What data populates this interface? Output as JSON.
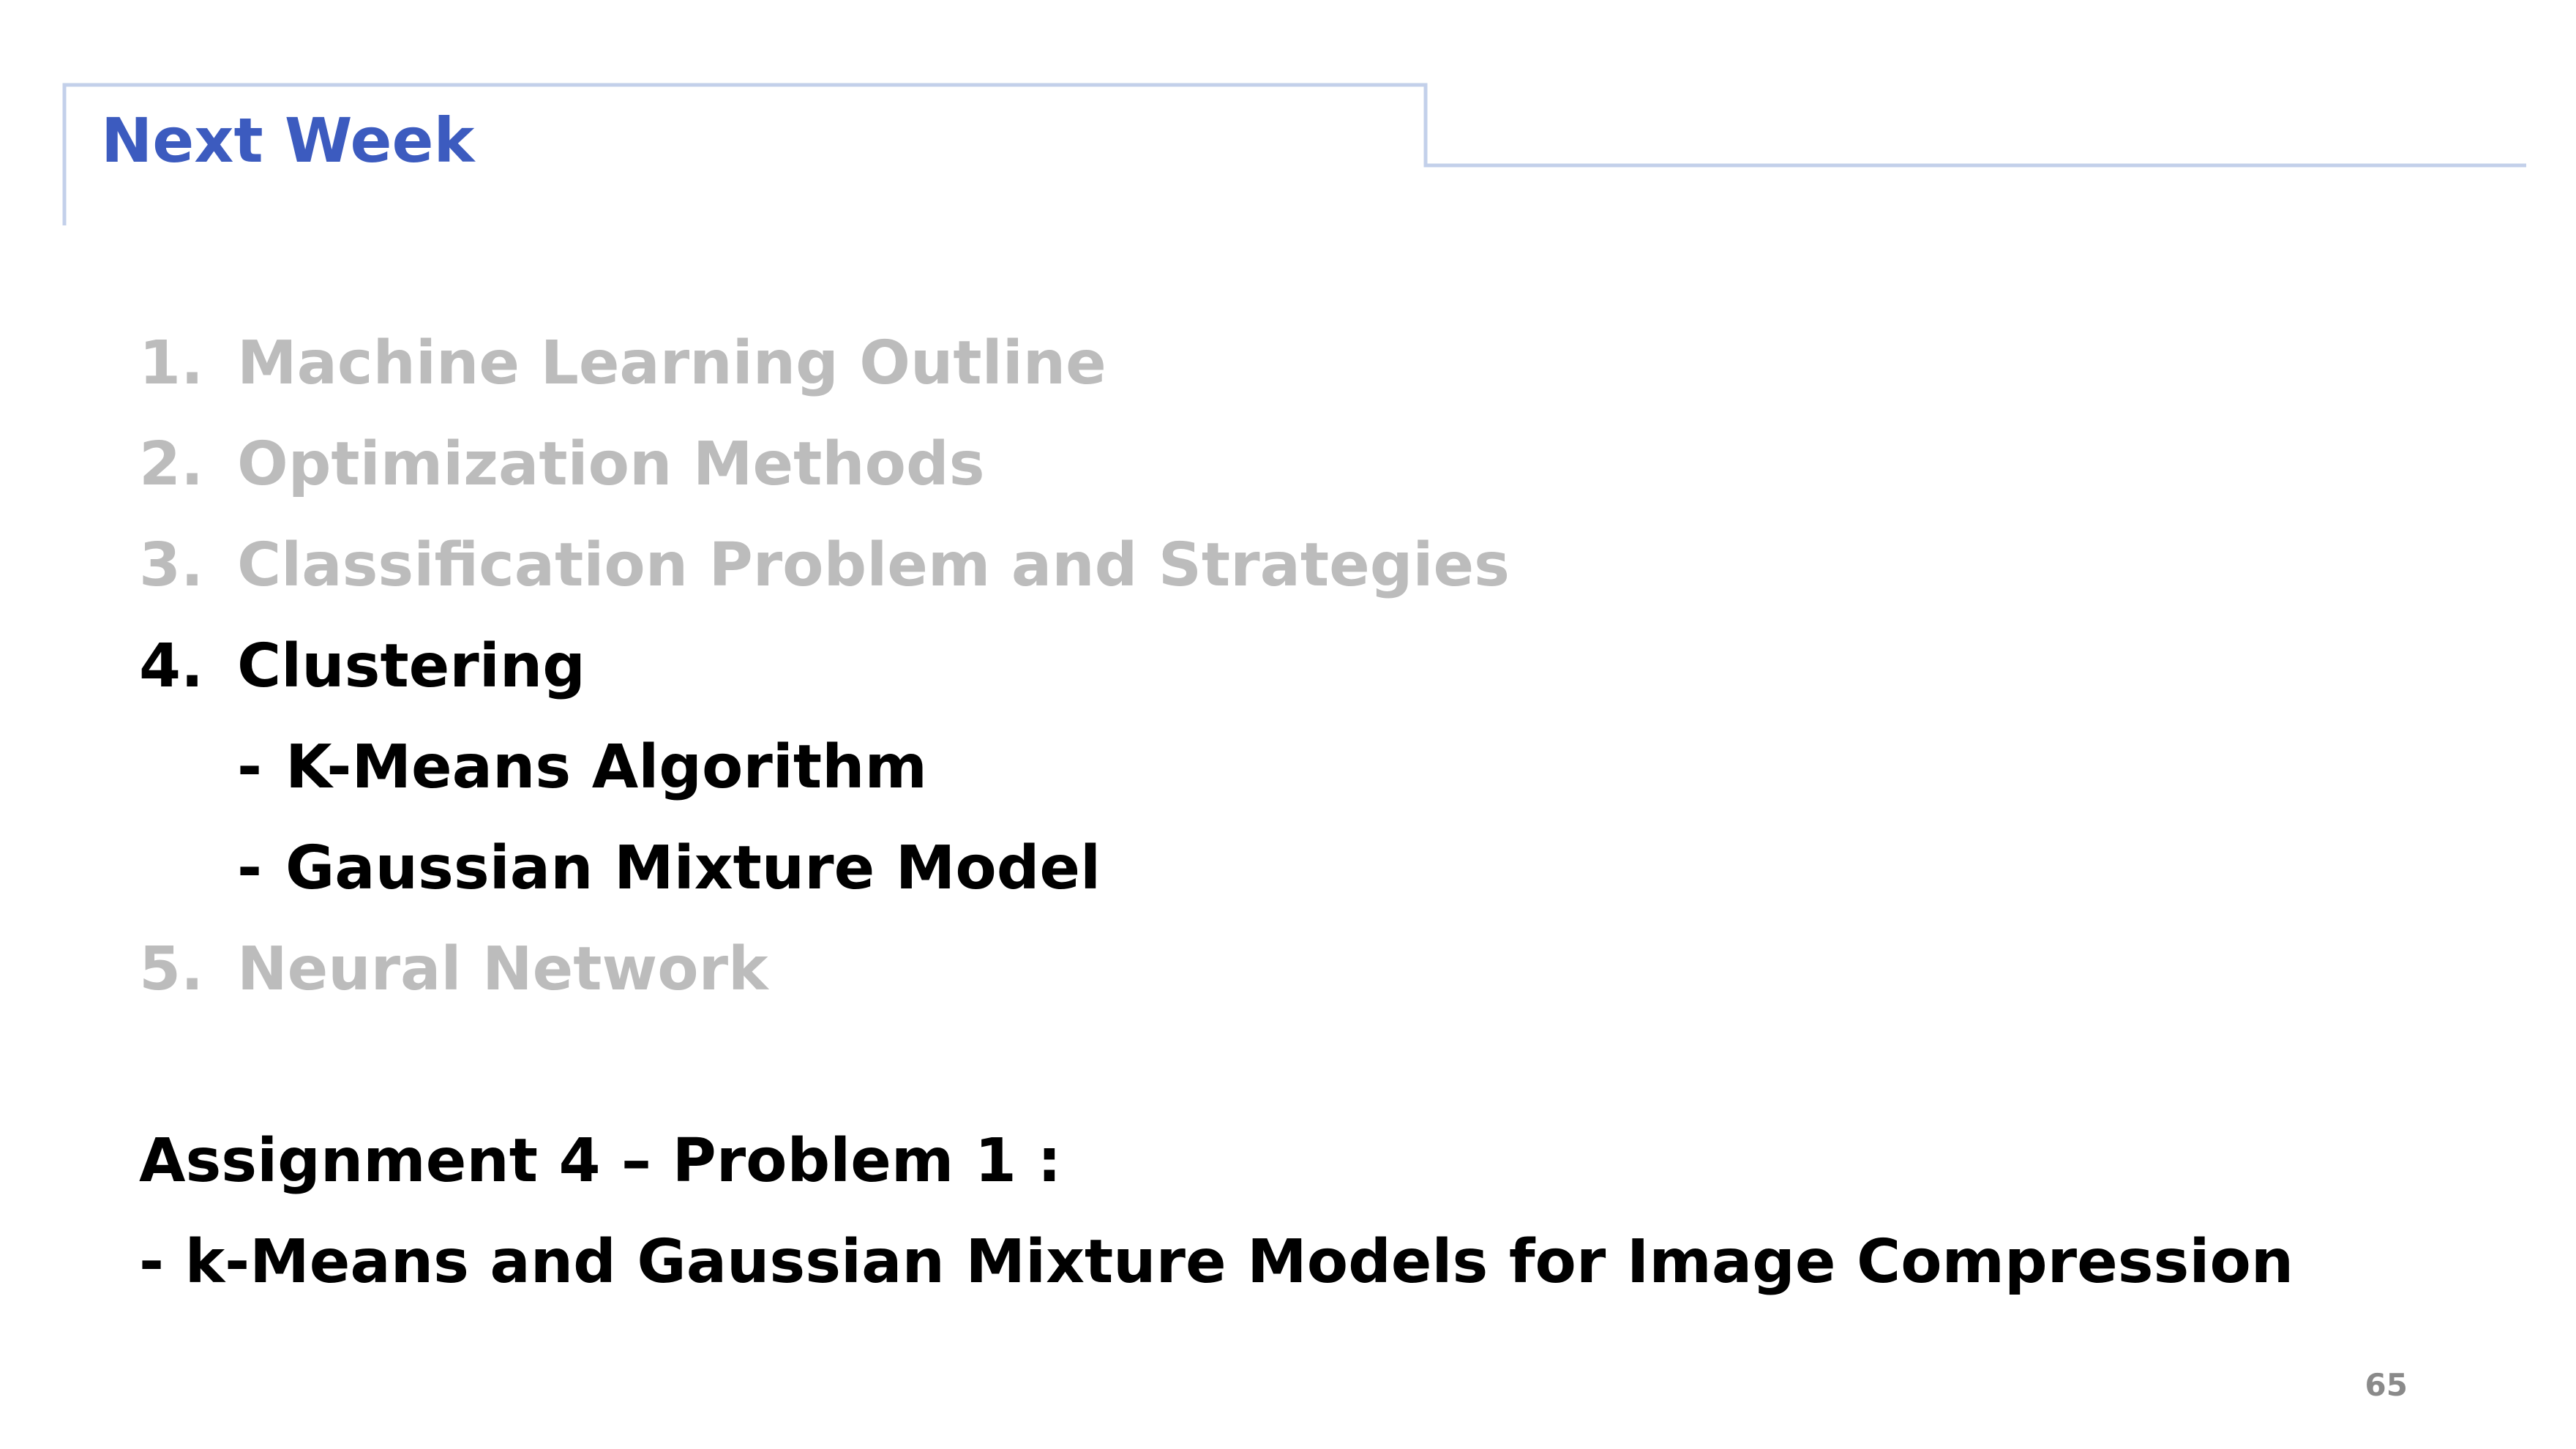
{
  "slide": {
    "title": "Next Week",
    "page_number": "65",
    "colors": {
      "title": "#3c5bbf",
      "frame_line": "#c3d0ea",
      "muted_text": "#bcbcbc",
      "active_text": "#000000",
      "page_number": "#8a8a8a"
    }
  },
  "outline": {
    "items": [
      {
        "number": "1.",
        "label": "Machine Learning Outline",
        "state": "muted"
      },
      {
        "number": "2.",
        "label": "Optimization Methods",
        "state": "muted"
      },
      {
        "number": "3.",
        "label": "Classification Problem and Strategies",
        "state": "muted"
      },
      {
        "number": "4.",
        "label": "Clustering",
        "state": "active"
      },
      {
        "number": "5.",
        "label": "Neural Network",
        "state": "muted"
      }
    ],
    "sub_items": [
      {
        "dash": "-",
        "label": "K-Means Algorithm"
      },
      {
        "dash": "-",
        "label": "Gaussian Mixture Model"
      }
    ]
  },
  "assignment": {
    "heading": "Assignment 4 – Problem 1 :",
    "detail": "- k-Means and Gaussian Mixture Models for Image Compression"
  }
}
